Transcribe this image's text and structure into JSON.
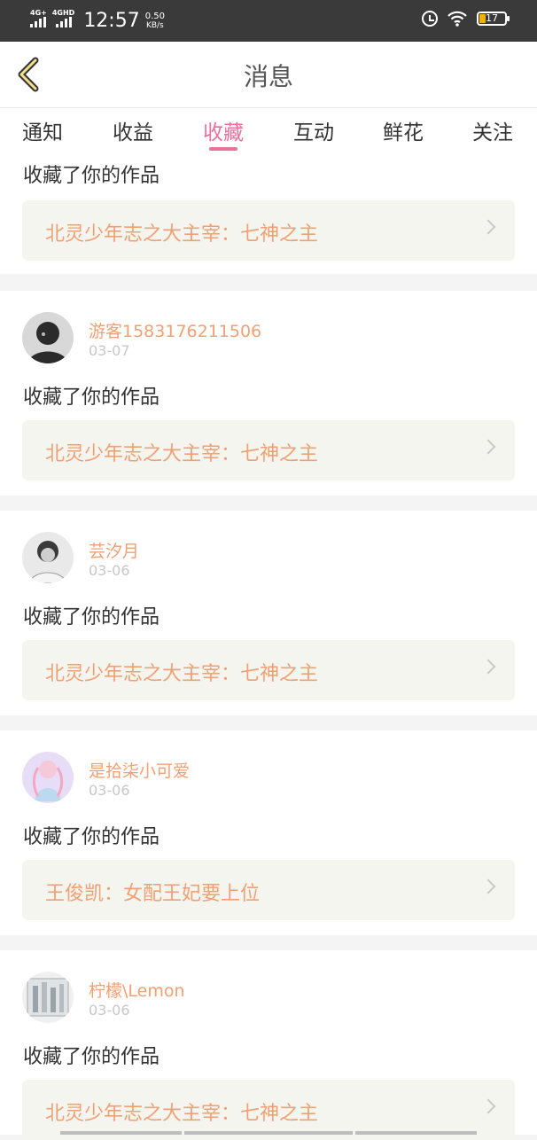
{
  "status_bar": {
    "signal1": "4G+",
    "signal2": "4GHD",
    "time": "12:57",
    "speed_value": "0.50",
    "speed_unit": "KB/s",
    "battery": "17",
    "icons": [
      "alarm-icon",
      "wifi-icon",
      "battery-icon"
    ]
  },
  "header": {
    "title": "消息",
    "back_icon": "chevron-left-icon"
  },
  "tabs": [
    {
      "label": "通知"
    },
    {
      "label": "收益"
    },
    {
      "label": "收藏"
    },
    {
      "label": "互动"
    },
    {
      "label": "鲜花"
    },
    {
      "label": "关注"
    }
  ],
  "active_tab": "收藏",
  "feed": [
    {
      "user": "",
      "date": "",
      "action": "收藏了你的作品",
      "work": "北灵少年志之大主宰：七神之主"
    },
    {
      "user": "游客1583176211506",
      "date": "03-07",
      "action": "收藏了你的作品",
      "work": "北灵少年志之大主宰：七神之主"
    },
    {
      "user": "芸汐月",
      "date": "03-06",
      "action": "收藏了你的作品",
      "work": "北灵少年志之大主宰：七神之主"
    },
    {
      "user": "是拾柒小可爱",
      "date": "03-06",
      "action": "收藏了你的作品",
      "work": "王俊凯：女配王妃要上位"
    },
    {
      "user": "柠檬\\Lemon",
      "date": "03-06",
      "action": "收藏了你的作品",
      "work": "北灵少年志之大主宰：七神之主"
    }
  ],
  "colors": {
    "accent": "#e8719c",
    "username": "#f0a073",
    "work_title": "#f0a073",
    "status_bg": "#3a3a3a"
  }
}
